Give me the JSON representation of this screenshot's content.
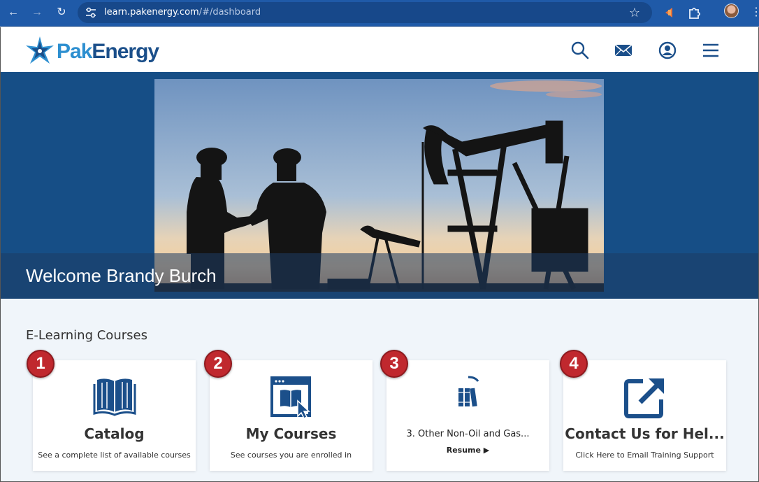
{
  "browser": {
    "url_host": "learn.pakenergy.com",
    "url_path": "/#/dashboard",
    "back_icon": "arrow-left-icon",
    "forward_icon": "arrow-right-icon",
    "reload_icon": "reload-icon",
    "bookmark_icon": "star-icon"
  },
  "header": {
    "logo_pak": "Pak",
    "logo_energy": "Energy",
    "icons": [
      "search-icon",
      "mail-icon",
      "user-icon",
      "menu-icon"
    ]
  },
  "hero": {
    "welcome": "Welcome Brandy Burch"
  },
  "main": {
    "section_title": "E-Learning Courses",
    "cards": [
      {
        "badge": "1",
        "icon": "book-icon",
        "title": "Catalog",
        "subtitle": "See a complete list of available courses"
      },
      {
        "badge": "2",
        "icon": "courses-window-icon",
        "title": "My Courses",
        "subtitle": "See courses you are enrolled in"
      },
      {
        "badge": "3",
        "icon": "books-icon",
        "course": "3. Other Non-Oil and Gas...",
        "resume": "Resume ▶"
      },
      {
        "badge": "4",
        "icon": "external-link-icon",
        "title": "Contact Us for Hel...",
        "subtitle": "Click Here to Email Training Support"
      }
    ]
  },
  "colors": {
    "brand_dark": "#164e86",
    "brand_light": "#2d8fd0",
    "badge_red": "#c0282e",
    "browser_blue": "#1f5aa8"
  }
}
